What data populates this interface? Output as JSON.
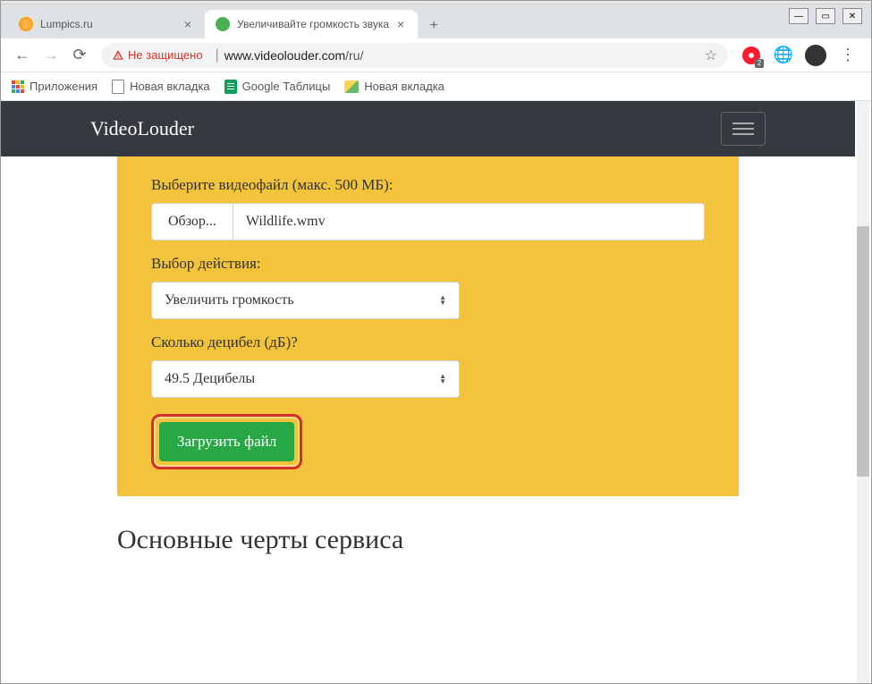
{
  "window": {
    "minimize": "—",
    "maximize": "▭",
    "close": "✕"
  },
  "tabs": [
    {
      "title": "Lumpics.ru"
    },
    {
      "title": "Увеличивайте громкость звука"
    }
  ],
  "addressBar": {
    "security_label": "Не защищено",
    "domain": "www.videolouder.com",
    "path": "/ru/"
  },
  "bookmarks": {
    "apps": "Приложения",
    "new_tab_1": "Новая вкладка",
    "sheets": "Google Таблицы",
    "new_tab_2": "Новая вкладка"
  },
  "toolbar": {
    "opera_badge": "2"
  },
  "page": {
    "brand": "VideoLouder",
    "form": {
      "file_label": "Выберите видеофайл (макс. 500 МБ):",
      "browse_btn": "Обзор...",
      "file_name": "Wildlife.wmv",
      "action_label": "Выбор действия:",
      "action_value": "Увеличить громкость",
      "decibel_label": "Сколько децибел (дБ)?",
      "decibel_value": "49.5 Децибелы",
      "upload_btn": "Загрузить файл"
    },
    "section_title": "Основные черты сервиса"
  }
}
